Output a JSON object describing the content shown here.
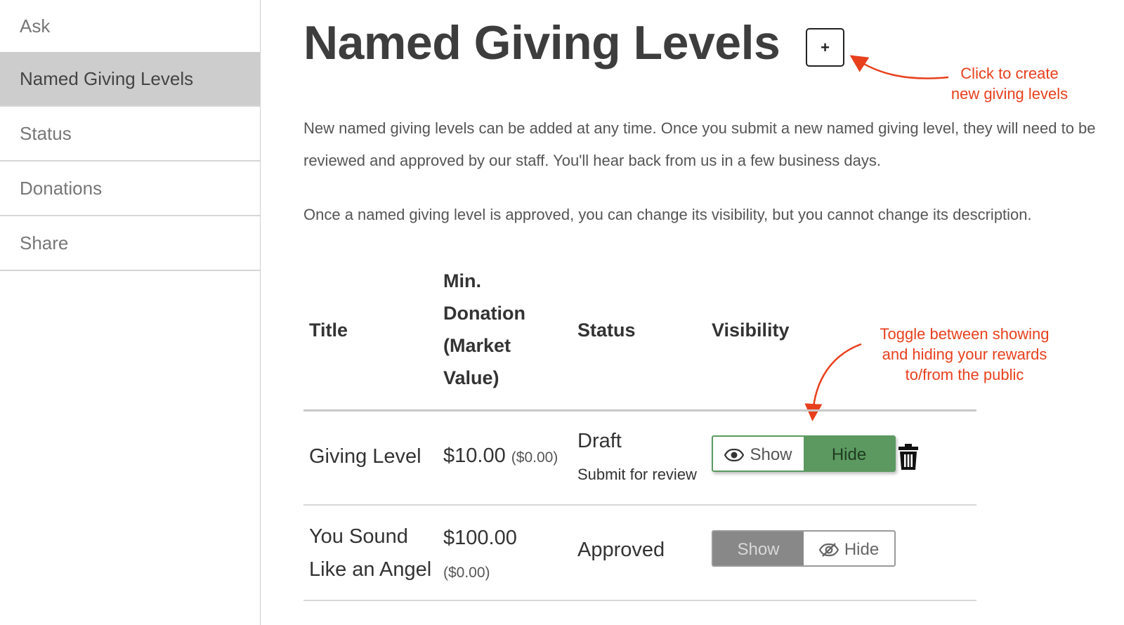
{
  "sidebar": {
    "items": [
      {
        "label": "Ask"
      },
      {
        "label": "Named Giving Levels"
      },
      {
        "label": "Status"
      },
      {
        "label": "Donations"
      },
      {
        "label": "Share"
      }
    ]
  },
  "main": {
    "title": "Named Giving Levels",
    "add_label": "+",
    "description1": "New named giving levels can be added at any time. Once you submit a new named giving level, they will need to be reviewed and approved by our staff. You'll hear back from us in a few business days.",
    "description2": "Once a named giving level is approved, you can change its visibility, but you cannot change its description."
  },
  "annotations": {
    "create_line1": "Click to create",
    "create_line2": "new giving levels",
    "toggle_line1": "Toggle between showing",
    "toggle_line2": "and hiding your rewards",
    "toggle_line3": "to/from the public",
    "color": "#e8401d"
  },
  "table": {
    "headers": {
      "title": "Title",
      "min_line1": "Min.",
      "min_line2": "Donation",
      "min_line3": "(Market",
      "min_line4": "Value)",
      "status": "Status",
      "visibility": "Visibility"
    },
    "rows": [
      {
        "title": "Giving Level",
        "min": "$10.00",
        "market": "($0.00)",
        "status": "Draft",
        "action": "Submit for review",
        "show_label": "Show",
        "hide_label": "Hide",
        "selected": "Hide"
      },
      {
        "title_line1": "You Sound",
        "title_line2": "Like an Angel",
        "min": "$100.00",
        "market": "($0.00)",
        "status": "Approved",
        "show_label": "Show",
        "hide_label": "Hide",
        "selected": "Show"
      }
    ]
  },
  "colors": {
    "link": "#4a9de0",
    "toggle_green": "#5b9960",
    "toggle_gray": "#888888",
    "sidebar_active": "#cdcdcd"
  },
  "icons": [
    "eye-icon",
    "eye-slash-icon",
    "trash-icon",
    "plus-icon"
  ]
}
